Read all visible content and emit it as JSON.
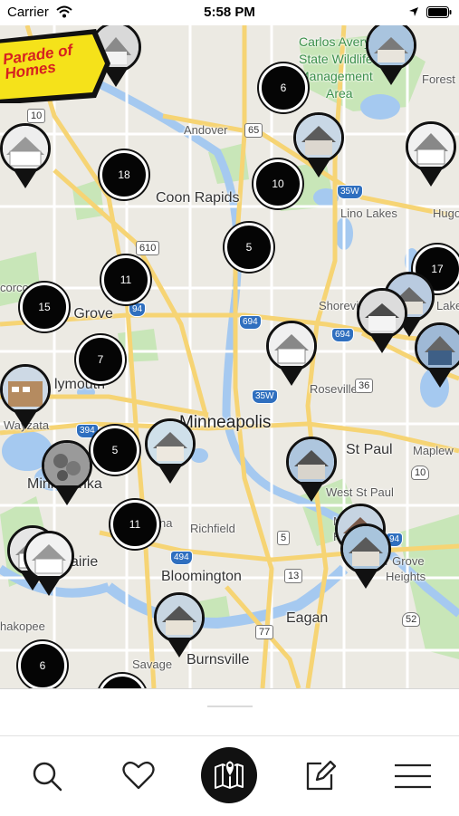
{
  "status_bar": {
    "carrier": "Carrier",
    "time": "5:58 PM"
  },
  "brand": {
    "logo_text": "Parade of Homes"
  },
  "map": {
    "places": [
      {
        "id": "carlos-avery",
        "text": "Carlos Avery"
      },
      {
        "id": "state-wildlife",
        "text": "State Wildlife"
      },
      {
        "id": "management",
        "text": "Management"
      },
      {
        "id": "area",
        "text": "Area"
      },
      {
        "id": "forest",
        "text": "Forest"
      },
      {
        "id": "andover",
        "text": "Andover"
      },
      {
        "id": "coon-rapids",
        "text": "Coon Rapids"
      },
      {
        "id": "lino-lakes",
        "text": "Lino Lakes"
      },
      {
        "id": "hugo",
        "text": "Hugo"
      },
      {
        "id": "corcoran",
        "text": "corcoran"
      },
      {
        "id": "maple-grove",
        "text": "e Grove"
      },
      {
        "id": "shoreview",
        "text": "Shoreview"
      },
      {
        "id": "lake",
        "text": "Lake"
      },
      {
        "id": "plymouth",
        "text": "lymouth"
      },
      {
        "id": "roseville",
        "text": "Roseville"
      },
      {
        "id": "wayzata",
        "text": "Wayzata"
      },
      {
        "id": "minneapolis",
        "text": "Minneapolis"
      },
      {
        "id": "st-paul",
        "text": "St Paul"
      },
      {
        "id": "maplewood",
        "text": "Maplew"
      },
      {
        "id": "minnetonka",
        "text": "Minnetonka"
      },
      {
        "id": "west-st-paul",
        "text": "West St Paul"
      },
      {
        "id": "edina",
        "text": "na"
      },
      {
        "id": "richfield",
        "text": "Richfield"
      },
      {
        "id": "mendota",
        "text": "Men"
      },
      {
        "id": "heights",
        "text": "Heig"
      },
      {
        "id": "prairie",
        "text": "airie"
      },
      {
        "id": "grove",
        "text": "er Grove"
      },
      {
        "id": "heights2",
        "text": "Heights"
      },
      {
        "id": "bloomington",
        "text": "Bloomington"
      },
      {
        "id": "eagan",
        "text": "Eagan"
      },
      {
        "id": "shakopee",
        "text": "hakopee"
      },
      {
        "id": "savage",
        "text": "Savage"
      },
      {
        "id": "burnsville",
        "text": "Burnsville"
      }
    ],
    "shields": [
      {
        "id": "s10",
        "text": "10"
      },
      {
        "id": "s65",
        "text": "65"
      },
      {
        "id": "s35w-n",
        "text": "35W"
      },
      {
        "id": "s610",
        "text": "610"
      },
      {
        "id": "s94",
        "text": "94"
      },
      {
        "id": "s694-w",
        "text": "694"
      },
      {
        "id": "s694-e",
        "text": "694"
      },
      {
        "id": "s35w-s",
        "text": "35W"
      },
      {
        "id": "s36",
        "text": "36"
      },
      {
        "id": "s394",
        "text": "394"
      },
      {
        "id": "s10b",
        "text": "10"
      },
      {
        "id": "s5",
        "text": "5"
      },
      {
        "id": "s494",
        "text": "494"
      },
      {
        "id": "s494e",
        "text": "94"
      },
      {
        "id": "s13",
        "text": "13"
      },
      {
        "id": "s77",
        "text": "77"
      },
      {
        "id": "s52",
        "text": "52"
      }
    ],
    "clusters": [
      {
        "id": "c-6-top",
        "count": "6"
      },
      {
        "id": "c-18",
        "count": "18"
      },
      {
        "id": "c-10",
        "count": "10"
      },
      {
        "id": "c-5-north",
        "count": "5"
      },
      {
        "id": "c-11-north",
        "count": "11"
      },
      {
        "id": "c-15",
        "count": "15"
      },
      {
        "id": "c-17",
        "count": "17"
      },
      {
        "id": "c-7",
        "count": "7"
      },
      {
        "id": "c-5-west",
        "count": "5"
      },
      {
        "id": "c-11-south",
        "count": "11"
      },
      {
        "id": "c-6-bottom",
        "count": "6"
      }
    ]
  },
  "tabs": [
    {
      "id": "search",
      "icon": "search-icon"
    },
    {
      "id": "favorites",
      "icon": "heart-icon"
    },
    {
      "id": "map",
      "icon": "map-icon",
      "active": true
    },
    {
      "id": "notes",
      "icon": "edit-icon"
    },
    {
      "id": "menu",
      "icon": "menu-icon"
    }
  ],
  "colors": {
    "map_land": "#eceae3",
    "water": "#a5c9f0",
    "park": "#c8e6b8",
    "highway": "#f6d474",
    "cluster": "#050505",
    "logo_yellow": "#f5e21a",
    "logo_red": "#d62020"
  }
}
